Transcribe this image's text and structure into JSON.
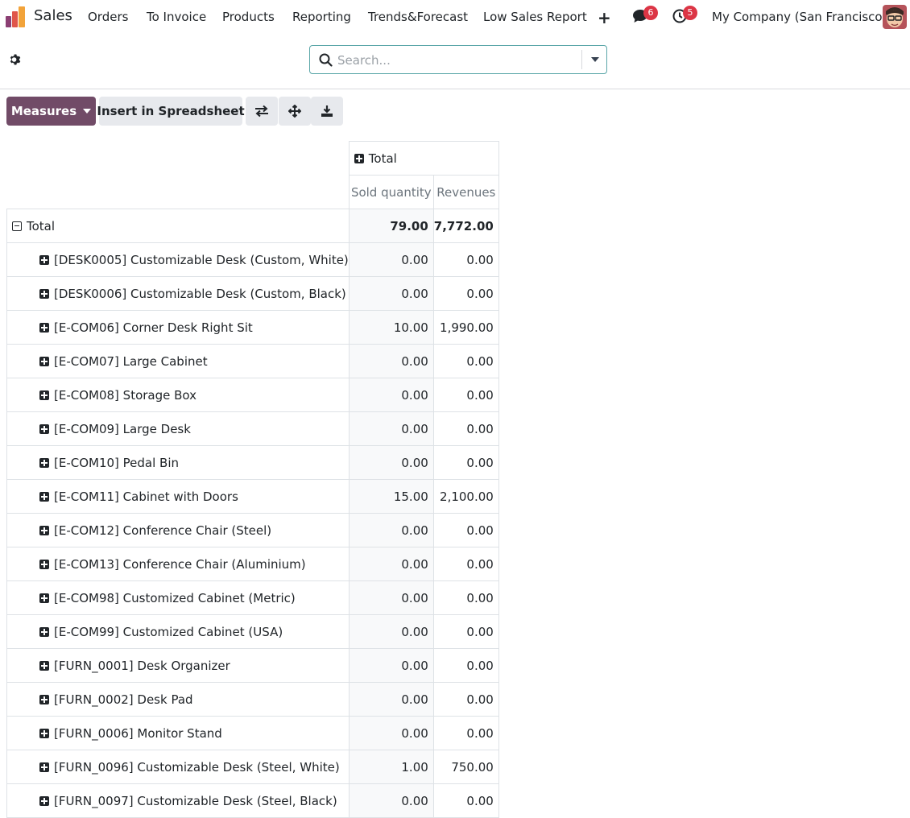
{
  "navbar": {
    "app_name": "Sales",
    "menus": [
      "Orders",
      "To Invoice",
      "Products",
      "Reporting",
      "Trends&Forecast",
      "Low Sales Report"
    ],
    "new_icon": "plus-icon",
    "messages_badge": "6",
    "activities_badge": "5",
    "company": "My Company (San Francisco)"
  },
  "control_panel": {
    "search_placeholder": "Search...",
    "measures_label": "Measures",
    "insert_label": "Insert in Spreadsheet"
  },
  "pivot": {
    "col_header": "Total",
    "measures": [
      "Sold quantity",
      "Revenues"
    ],
    "total_row": {
      "label": "Total",
      "qty": "79.00",
      "rev": "7,772.00"
    },
    "rows": [
      {
        "label": "[DESK0005] Customizable Desk (Custom, White)",
        "qty": "0.00",
        "rev": "0.00"
      },
      {
        "label": "[DESK0006] Customizable Desk (Custom, Black)",
        "qty": "0.00",
        "rev": "0.00"
      },
      {
        "label": "[E-COM06] Corner Desk Right Sit",
        "qty": "10.00",
        "rev": "1,990.00"
      },
      {
        "label": "[E-COM07] Large Cabinet",
        "qty": "0.00",
        "rev": "0.00"
      },
      {
        "label": "[E-COM08] Storage Box",
        "qty": "0.00",
        "rev": "0.00"
      },
      {
        "label": "[E-COM09] Large Desk",
        "qty": "0.00",
        "rev": "0.00"
      },
      {
        "label": "[E-COM10] Pedal Bin",
        "qty": "0.00",
        "rev": "0.00"
      },
      {
        "label": "[E-COM11] Cabinet with Doors",
        "qty": "15.00",
        "rev": "2,100.00"
      },
      {
        "label": "[E-COM12] Conference Chair (Steel)",
        "qty": "0.00",
        "rev": "0.00"
      },
      {
        "label": "[E-COM13] Conference Chair (Aluminium)",
        "qty": "0.00",
        "rev": "0.00"
      },
      {
        "label": "[E-COM98] Customized Cabinet (Metric)",
        "qty": "0.00",
        "rev": "0.00"
      },
      {
        "label": "[E-COM99] Customized Cabinet (USA)",
        "qty": "0.00",
        "rev": "0.00"
      },
      {
        "label": "[FURN_0001] Desk Organizer",
        "qty": "0.00",
        "rev": "0.00"
      },
      {
        "label": "[FURN_0002] Desk Pad",
        "qty": "0.00",
        "rev": "0.00"
      },
      {
        "label": "[FURN_0006] Monitor Stand",
        "qty": "0.00",
        "rev": "0.00"
      },
      {
        "label": "[FURN_0096] Customizable Desk (Steel, White)",
        "qty": "1.00",
        "rev": "750.00"
      },
      {
        "label": "[FURN_0097] Customizable Desk (Steel, Black)",
        "qty": "0.00",
        "rev": "0.00"
      }
    ]
  },
  "colors": {
    "brand": "#714b67",
    "badge": "#dc3545",
    "search_border": "#5aa6a8"
  }
}
